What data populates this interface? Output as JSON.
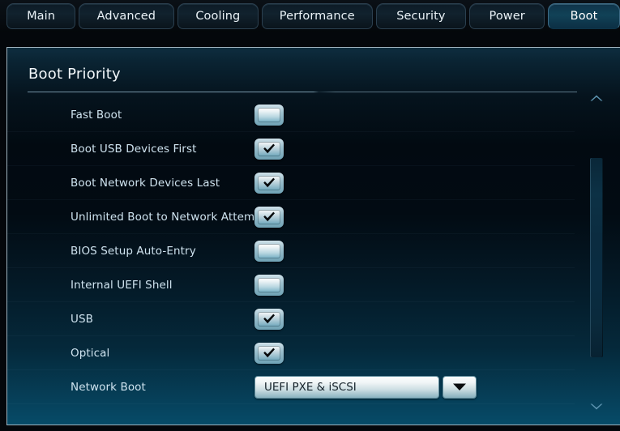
{
  "tabs": [
    {
      "label": "Main",
      "id": "main",
      "active": false
    },
    {
      "label": "Advanced",
      "id": "advanced",
      "active": false
    },
    {
      "label": "Cooling",
      "id": "cooling",
      "active": false
    },
    {
      "label": "Performance",
      "id": "performance",
      "active": false
    },
    {
      "label": "Security",
      "id": "security",
      "active": false
    },
    {
      "label": "Power",
      "id": "power",
      "active": false
    },
    {
      "label": "Boot",
      "id": "boot",
      "active": true
    }
  ],
  "panel": {
    "title": "Boot Priority"
  },
  "rows": [
    {
      "label": "Fast Boot",
      "control": "checkbox",
      "checked": false
    },
    {
      "label": "Boot USB Devices First",
      "control": "checkbox",
      "checked": true
    },
    {
      "label": "Boot Network Devices Last",
      "control": "checkbox",
      "checked": true
    },
    {
      "label": "Unlimited Boot to Network Attempts",
      "control": "checkbox",
      "checked": true
    },
    {
      "label": "BIOS Setup Auto-Entry",
      "control": "checkbox",
      "checked": false
    },
    {
      "label": "Internal UEFI Shell",
      "control": "checkbox",
      "checked": false
    },
    {
      "label": "USB",
      "control": "checkbox",
      "checked": true
    },
    {
      "label": "Optical",
      "control": "checkbox",
      "checked": true
    },
    {
      "label": "Network Boot",
      "control": "dropdown",
      "value": "UEFI PXE & iSCSI"
    }
  ],
  "scrollbar": {
    "up_icon": "chevron-up-icon",
    "down_icon": "chevron-down-icon"
  },
  "icons": {
    "checkmark": "check-icon",
    "dropdown_arrow": "triangle-down-icon"
  },
  "colors": {
    "accent": "#0d3449",
    "panel_top": "#0e2d3f",
    "panel_bottom": "#064b68",
    "tab_active": "#114257",
    "label_text": "#cfe3ef",
    "title_text": "#f2f7fa",
    "field_text": "#15222a"
  }
}
